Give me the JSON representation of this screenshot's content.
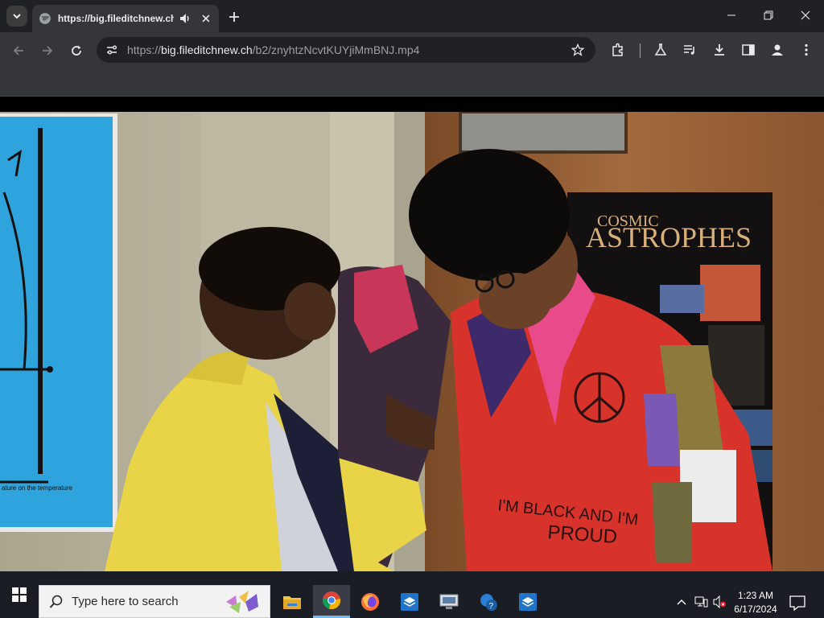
{
  "browser": {
    "tab": {
      "title": "https://big.fileditchnew.ch",
      "audio_icon": "speaker-icon",
      "favicon": "globe-icon"
    },
    "url": {
      "scheme": "https://",
      "host": "big.fileditchnew.ch",
      "path": "/b2/znyhtzNcvtKUYjiMmBNJ.mp4"
    },
    "toolbar_icons": [
      "extensions-icon",
      "labs-icon",
      "media-controls-icon",
      "download-icon",
      "side-panel-icon",
      "profile-icon",
      "menu-icon"
    ]
  },
  "video": {
    "poster_title_line1": "COSMIC",
    "poster_title_line2": "ASTROPHES",
    "chart_caption": "ature on the temperature",
    "jacket_text_line1": "I'M BLACK AND I'M",
    "jacket_text_line2": "PROUD"
  },
  "taskbar": {
    "search_placeholder": "Type here to search",
    "apps": [
      "file-explorer-icon",
      "chrome-icon",
      "firefox-icon",
      "sandbox-icon",
      "remote-desktop-icon",
      "help-icon",
      "sandbox-icon-2"
    ],
    "time": "1:23 AM",
    "date": "6/17/2024"
  },
  "colors": {
    "tab_bg": "#35363a",
    "chrome_dark": "#202124",
    "taskbar_bg": "#1b1d24",
    "accent": "#76b9ed"
  }
}
